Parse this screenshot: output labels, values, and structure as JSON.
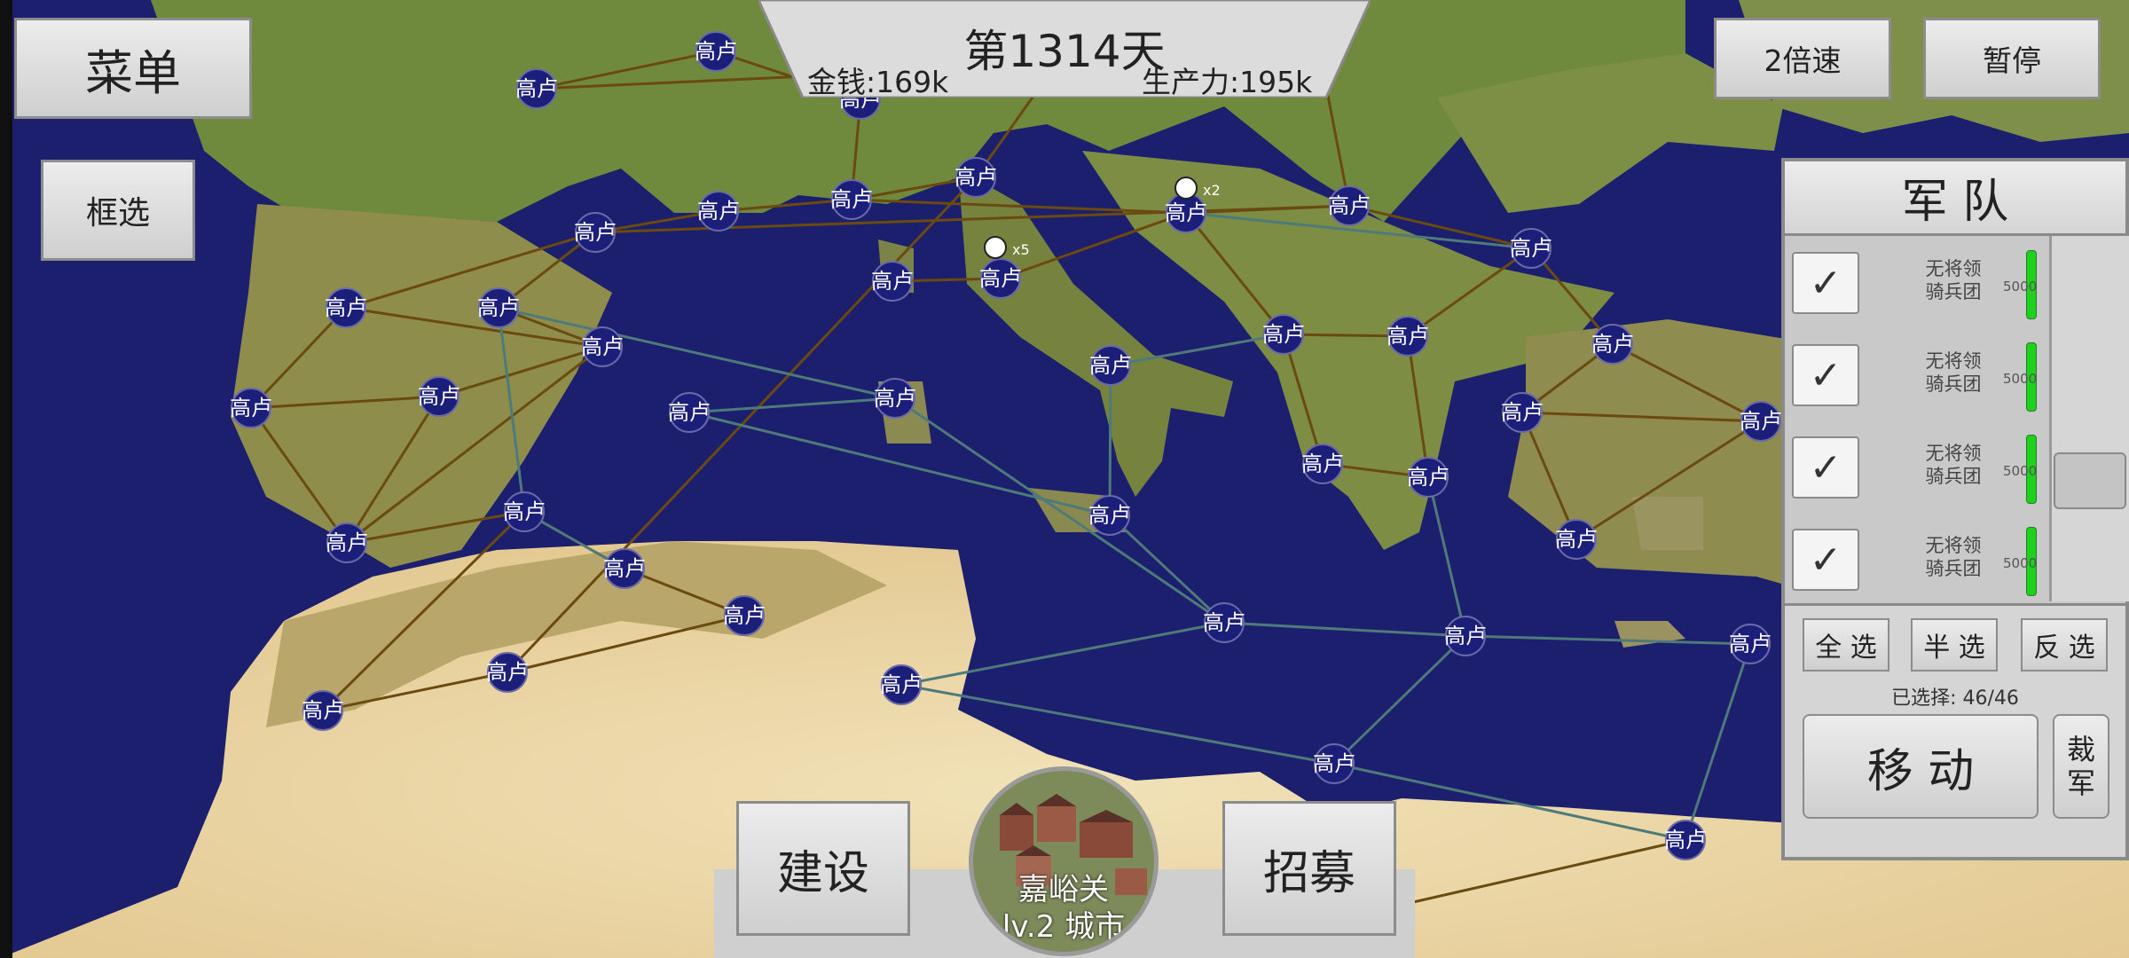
{
  "top": {
    "day": "第1314天",
    "money": "金钱:169k",
    "production": "生产力:195k"
  },
  "buttons": {
    "menu": "菜单",
    "box_select": "框选",
    "speed": "2倍速",
    "pause": "暂停",
    "build": "建设",
    "recruit": "招募"
  },
  "city_card": {
    "name": "嘉峪关",
    "level": "lv.2 城市"
  },
  "army": {
    "title": "军 队",
    "units": [
      {
        "line1": "无将领",
        "line2": "骑兵团",
        "count": "5000"
      },
      {
        "line1": "无将领",
        "line2": "骑兵团",
        "count": "5000"
      },
      {
        "line1": "无将领",
        "line2": "骑兵团",
        "count": "5000"
      },
      {
        "line1": "无将领",
        "line2": "骑兵团",
        "count": "5000"
      }
    ],
    "select_all": "全 选",
    "select_half": "半 选",
    "select_invert": "反 选",
    "selected": "已选择: 46/46",
    "move": "移 动",
    "disband": "裁\n军"
  },
  "map": {
    "city_label": "高卢",
    "troops": [
      {
        "label": "x2"
      },
      {
        "label": "x5"
      }
    ],
    "colors": {
      "sea": "#1b1f6e",
      "node": "#1c1f7a",
      "land_road": "#6b4a10",
      "sea_route": "#4e7a7a"
    }
  }
}
